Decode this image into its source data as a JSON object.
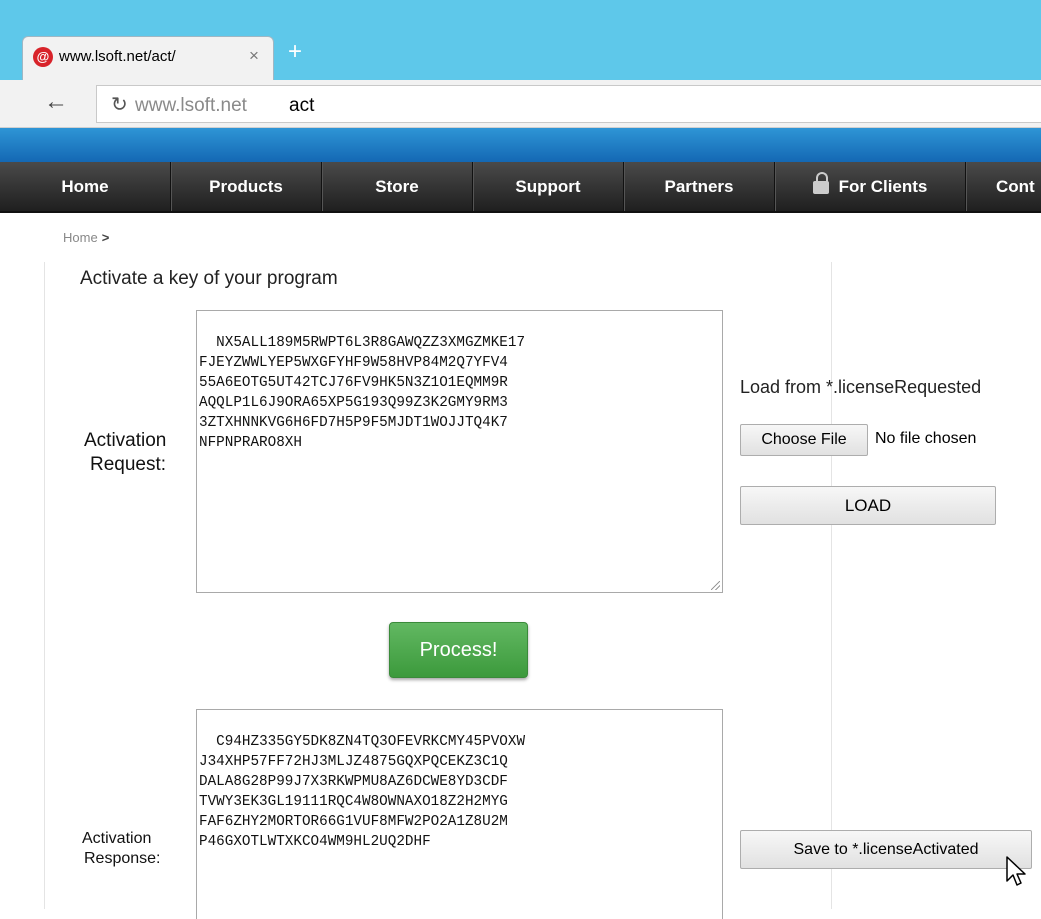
{
  "browser": {
    "tab_title": "www.lsoft.net/act/",
    "tab_close": "×",
    "new_tab": "+",
    "back": "←",
    "reload": "↻",
    "address_host": "www.lsoft.net",
    "address_path": "act"
  },
  "nav": {
    "items": [
      "Home",
      "Products",
      "Store",
      "Support",
      "Partners",
      "For Clients",
      "Cont"
    ]
  },
  "breadcrumb": {
    "home": "Home",
    "separator": ">"
  },
  "page": {
    "heading": "Activate a key of your program",
    "request_label_1": "Activation",
    "request_label_2": "Request:",
    "request_text": "NX5ALL189M5RWPT6L3R8GAWQZZ3XMGZMKE17\nFJEYZWWLYEP5WXGFYHF9W58HVP84M2Q7YFV4\n55A6EOTG5UT42TCJ76FV9HK5N3Z1O1EQMM9R\nAQQLP1L6J9ORA65XP5G193Q99Z3K2GMY9RM3\n3ZTXHNNKVG6H6FD7H5P9F5MJDT1WOJJTQ4K7\nNFPNPRARO8XH",
    "process_button": "Process!",
    "response_label_1": "Activation",
    "response_label_2": "Response:",
    "response_text": "C94HZ335GY5DK8ZN4TQ3OFEVRKCMY45PVOXW\nJ34XHP57FF72HJ3MLJZ4875GQXPQCEKZ3C1Q\nDALA8G28P99J7X3RKWPMU8AZ6DCWE8YD3CDF\nTVWY3EK3GL19111RQC4W8OWNAXO18Z2H2MYG\nFAF6ZHY2MORTOR66G1VUF8MFW2PO2A1Z8U2M\nP46GXOTLWTXKCO4WM9HL2UQ2DHF"
  },
  "side": {
    "load_from": "Load from *.licenseRequested",
    "choose_file": "Choose File",
    "no_file": "No file chosen",
    "load_button": "LOAD",
    "save_button": "Save to *.licenseActivated"
  }
}
